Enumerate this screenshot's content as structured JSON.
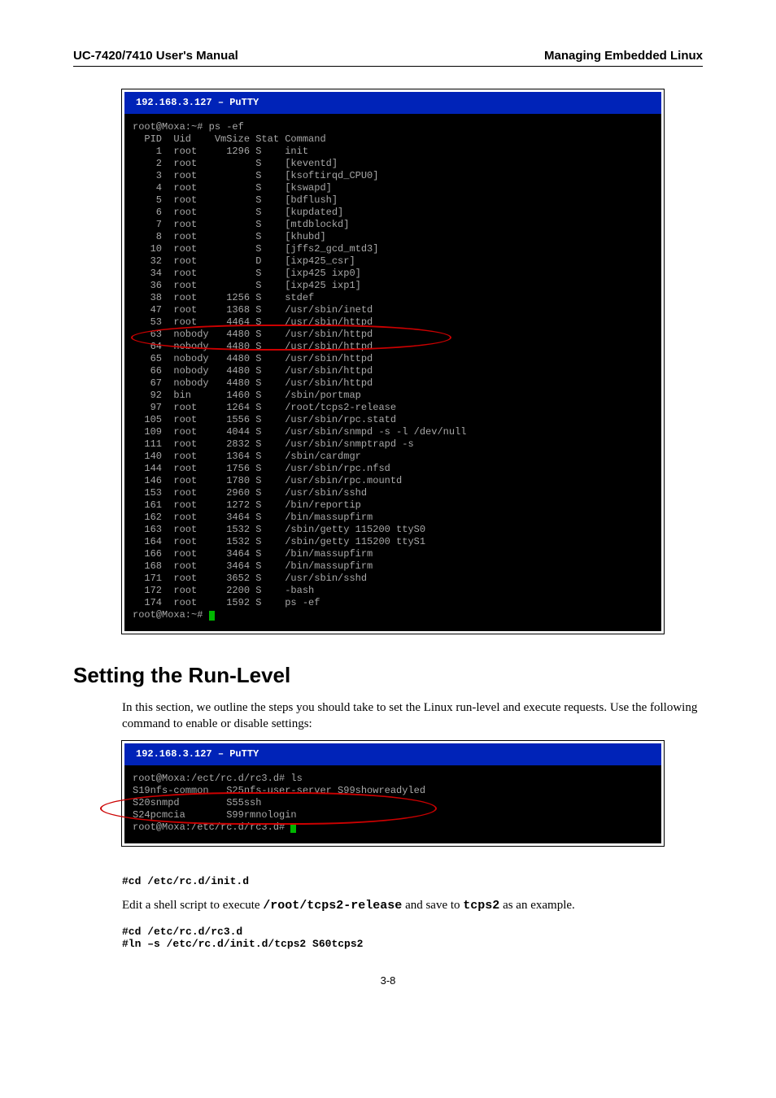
{
  "header": {
    "left": "UC-7420/7410 User's Manual",
    "right": "Managing Embedded Linux"
  },
  "term1": {
    "title": "  192.168.3.127 – PuTTY",
    "lines_top": "root@Moxa:~# ps -ef\n  PID  Uid    VmSize Stat Command\n    1  root     1296 S    init\n    2  root          S    [keventd]\n    3  root          S    [ksoftirqd_CPU0]\n    4  root          S    [kswapd]\n    5  root          S    [bdflush]\n    6  root          S    [kupdated]\n    7  root          S    [mtdblockd]\n    8  root          S    [khubd]\n   10  root          S    [jffs2_gcd_mtd3]\n   32  root          D    [ixp425_csr]\n   34  root          S    [ixp425 ixp0]\n   36  root          S    [ixp425 ixp1]\n   38  root     1256 S    stdef\n   47  root     1368 S    /usr/sbin/inetd\n   53  root     4464 S    /usr/sbin/httpd\n   63  nobody   4480 S    /usr/sbin/httpd\n   64  nobody   4480 S    /usr/sbin/httpd\n   65  nobody   4480 S    /usr/sbin/httpd\n   66  nobody   4480 S    /usr/sbin/httpd\n   67  nobody   4480 S    /usr/sbin/httpd\n   92  bin      1460 S    /sbin/portmap\n   97  root     1264 S    /root/tcps2-release\n  105  root     1556 S    /usr/sbin/rpc.statd\n  109  root     4044 S    /usr/sbin/snmpd -s -l /dev/null\n  111  root     2832 S    /usr/sbin/snmptrapd -s\n  140  root     1364 S    /sbin/cardmgr\n  144  root     1756 S    /usr/sbin/rpc.nfsd\n  146  root     1780 S    /usr/sbin/rpc.mountd\n  153  root     2960 S    /usr/sbin/sshd\n  161  root     1272 S    /bin/reportip\n  162  root     3464 S    /bin/massupfirm\n  163  root     1532 S    /sbin/getty 115200 ttyS0\n  164  root     1532 S    /sbin/getty 115200 ttyS1\n  166  root     3464 S    /bin/massupfirm\n  168  root     3464 S    /bin/massupfirm\n  171  root     3652 S    /usr/sbin/sshd\n  172  root     2200 S    -bash\n  174  root     1592 S    ps -ef",
    "prompt": "root@Moxa:~# "
  },
  "section": {
    "title": "Setting the Run-Level",
    "para1": "In this section, we outline the steps you should take to set the Linux run-level and execute requests. Use the following command to enable or disable settings:"
  },
  "term2": {
    "title": "  192.168.3.127 – PuTTY",
    "lines": "root@Moxa:/ect/rc.d/rc3.d# ls\nS19nfs-common   S25nfs-user-server S99showreadyled\nS20snmpd        S55ssh\nS24pcmcia       S99rmnologin",
    "prompt": "root@Moxa:/etc/rc.d/rc3.d# "
  },
  "cmd1": "#cd /etc/rc.d/init.d",
  "para2a": "Edit a shell script to execute ",
  "para2b": "/root/tcps2-release",
  "para2c": " and save to ",
  "para2d": "tcps2",
  "para2e": " as an example.",
  "cmd2": "#cd /etc/rc.d/rc3.d\n#ln –s /etc/rc.d/init.d/tcps2 S60tcps2",
  "page_number": "3-8"
}
